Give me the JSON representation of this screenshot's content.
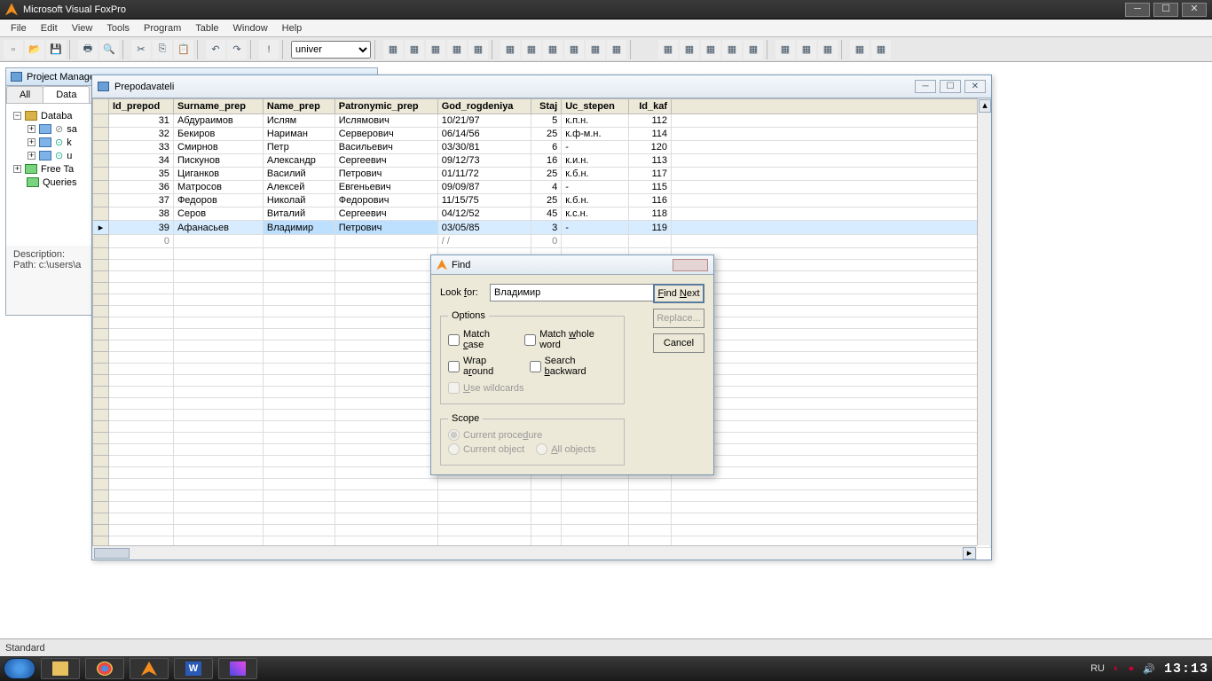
{
  "app": {
    "title": "Microsoft Visual FoxPro"
  },
  "menu": [
    "File",
    "Edit",
    "View",
    "Tools",
    "Program",
    "Table",
    "Window",
    "Help"
  ],
  "toolbar": {
    "combo": "univer"
  },
  "pm": {
    "title": "Project Manager",
    "tabs": [
      "All",
      "Data"
    ],
    "tree": {
      "databa": "Databa",
      "sa": "sa",
      "free": "Free Ta",
      "queries": "Queries"
    },
    "desc1": "Description:",
    "desc2": "Path: c:\\users\\a"
  },
  "browse": {
    "title": "Prepodavateli",
    "cols": [
      "Id_prepod",
      "Surname_prep",
      "Name_prep",
      "Patronymic_prep",
      "God_rogdeniya",
      "Staj",
      "Uc_stepen",
      "Id_kaf"
    ],
    "rows": [
      {
        "id": "31",
        "sn": "Абдураимов",
        "nm": "Ислям",
        "pt": "Ислямович",
        "dt": "10/21/97",
        "st": "5",
        "uc": "к.п.н.",
        "kf": "112"
      },
      {
        "id": "32",
        "sn": "Бекиров",
        "nm": "Нариман",
        "pt": "Серверович",
        "dt": "06/14/56",
        "st": "25",
        "uc": "к.ф-м.н.",
        "kf": "114"
      },
      {
        "id": "33",
        "sn": "Смирнов",
        "nm": "Петр",
        "pt": "Васильевич",
        "dt": "03/30/81",
        "st": "6",
        "uc": "-",
        "kf": "120"
      },
      {
        "id": "34",
        "sn": "Пискунов",
        "nm": "Александр",
        "pt": "Сергеевич",
        "dt": "09/12/73",
        "st": "16",
        "uc": "к.и.н.",
        "kf": "113"
      },
      {
        "id": "35",
        "sn": "Циганков",
        "nm": "Василий",
        "pt": "Петрович",
        "dt": "01/11/72",
        "st": "25",
        "uc": "к.б.н.",
        "kf": "117"
      },
      {
        "id": "36",
        "sn": "Матросов",
        "nm": "Алексей",
        "pt": "Евгеньевич",
        "dt": "09/09/87",
        "st": "4",
        "uc": "-",
        "kf": "115"
      },
      {
        "id": "37",
        "sn": "Федоров",
        "nm": "Николай",
        "pt": "Федорович",
        "dt": "11/15/75",
        "st": "25",
        "uc": "к.б.н.",
        "kf": "116"
      },
      {
        "id": "38",
        "sn": "Серов",
        "nm": "Виталий",
        "pt": "Сергеевич",
        "dt": "04/12/52",
        "st": "45",
        "uc": "к.с.н.",
        "kf": "118"
      },
      {
        "id": "39",
        "sn": "Афанасьев",
        "nm": "Владимир",
        "pt": "Петрович",
        "dt": "03/05/85",
        "st": "3",
        "uc": "-",
        "kf": "119"
      }
    ],
    "empty": {
      "id": "0",
      "dt": "/  /",
      "st": "0"
    }
  },
  "find": {
    "title": "Find",
    "look_for_label": "Look for:",
    "look_for_value": "Владимир",
    "options": "Options",
    "match_case": "Match case",
    "match_whole": "Match whole word",
    "wrap": "Wrap around",
    "search_back": "Search backward",
    "wildcards": "Use wildcards",
    "scope": "Scope",
    "cur_proc": "Current procedure",
    "cur_obj": "Current object",
    "all_obj": "All objects",
    "find_next": "Find Next",
    "replace": "Replace...",
    "cancel": "Cancel"
  },
  "status": {
    "text": "Standard"
  },
  "taskbar": {
    "lang": "RU",
    "clock": "13:13"
  }
}
